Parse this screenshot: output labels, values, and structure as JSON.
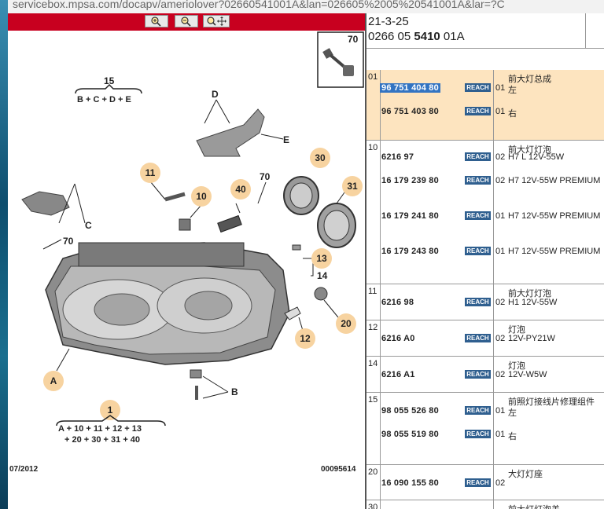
{
  "browser": {
    "url": "servicebox.mpsa.com/docapv/ameriolover?02660541001A&lan=026605%2005%20541001A&lar=?C"
  },
  "toolbar": {
    "zoom_in_icon": "zoom-in-icon",
    "zoom_out_icon": "zoom-out-icon",
    "zoom_move_icon": "zoom-move-icon",
    "accent": "#c8001f"
  },
  "diagram": {
    "labels": {
      "l15": "15",
      "l15_formula": "B + C + D + E",
      "lD": "D",
      "lE": "E",
      "lC": "C",
      "lB": "B",
      "lA": "A",
      "l70_inset": "70",
      "l70a": "70",
      "l70b": "70",
      "l11": "11",
      "l10": "10",
      "l40": "40",
      "l30": "30",
      "l31": "31",
      "l13": "13",
      "l14": "14",
      "l20": "20",
      "l12": "12",
      "l1": "1",
      "l1_formula_a": "A + 10 + 11 + 12 + 13",
      "l1_formula_b": "+ 20 + 30 + 31 + 40"
    },
    "date": "07/2012",
    "ref": "00095614"
  },
  "header": {
    "line1": "21-3-25",
    "line2_pre": "0266 05 ",
    "line2_bold": "5410",
    "line2_post": " 01A"
  },
  "groups": [
    {
      "num": "01",
      "title": "前大灯总成",
      "selected": true,
      "parts": [
        {
          "pn": "96 751 404 80",
          "reach": "REACH",
          "qty": "01",
          "desc": "左",
          "hl": true
        },
        {
          "pn": "96 751 403 80",
          "reach": "REACH",
          "qty": "01",
          "desc": "右"
        }
      ]
    },
    {
      "num": "10",
      "title": "前大灯灯泡",
      "parts": [
        {
          "pn": "6216 97",
          "reach": "REACH",
          "qty": "02",
          "desc": "H7 L 12V-55W"
        },
        {
          "pn": "16 179 239 80",
          "reach": "REACH",
          "qty": "02",
          "desc": "H7 12V-55W PREMIUM"
        },
        {
          "pn": "16 179 241 80",
          "reach": "REACH",
          "qty": "01",
          "desc": "H7 12V-55W PREMIUM"
        },
        {
          "pn": "16 179 243 80",
          "reach": "REACH",
          "qty": "01",
          "desc": "H7 12V-55W PREMIUM"
        }
      ]
    },
    {
      "num": "11",
      "title": "前大灯灯泡",
      "parts": [
        {
          "pn": "6216 98",
          "reach": "REACH",
          "qty": "02",
          "desc": "H1 12V-55W"
        }
      ]
    },
    {
      "num": "12",
      "title": "灯泡",
      "parts": [
        {
          "pn": "6216 A0",
          "reach": "REACH",
          "qty": "02",
          "desc": "12V-PY21W"
        }
      ]
    },
    {
      "num": "14",
      "title": "灯泡",
      "parts": [
        {
          "pn": "6216 A1",
          "reach": "REACH",
          "qty": "02",
          "desc": "12V-W5W"
        }
      ]
    },
    {
      "num": "15",
      "title": "前照灯接线片修理组件",
      "parts": [
        {
          "pn": "98 055 526 80",
          "reach": "REACH",
          "qty": "01",
          "desc": "左"
        },
        {
          "pn": "98 055 519 80",
          "reach": "REACH",
          "qty": "01",
          "desc": "右"
        }
      ]
    },
    {
      "num": "20",
      "title": "大灯灯座",
      "parts": [
        {
          "pn": "16 090 155 80",
          "reach": "REACH",
          "qty": "02",
          "desc": ""
        }
      ]
    },
    {
      "num": "30",
      "title": "前大灯灯泡盖",
      "parts": []
    }
  ]
}
